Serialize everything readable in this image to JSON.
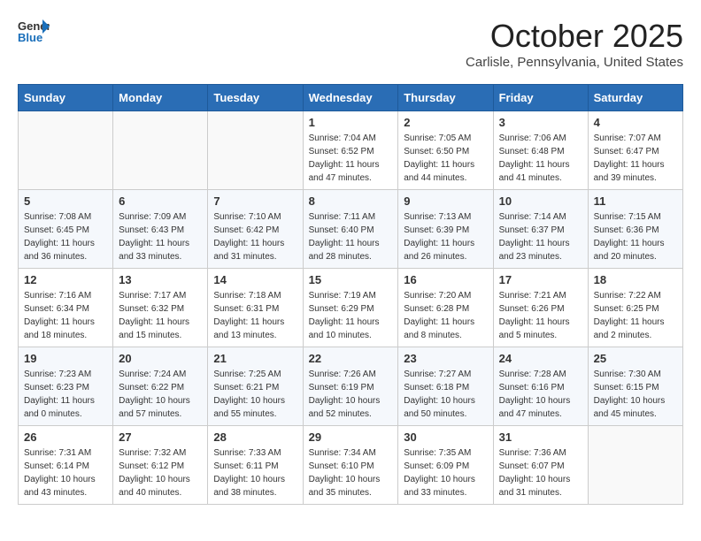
{
  "header": {
    "logo_line1": "General",
    "logo_line2": "Blue",
    "month": "October 2025",
    "location": "Carlisle, Pennsylvania, United States"
  },
  "weekdays": [
    "Sunday",
    "Monday",
    "Tuesday",
    "Wednesday",
    "Thursday",
    "Friday",
    "Saturday"
  ],
  "weeks": [
    [
      {
        "day": "",
        "info": ""
      },
      {
        "day": "",
        "info": ""
      },
      {
        "day": "",
        "info": ""
      },
      {
        "day": "1",
        "info": "Sunrise: 7:04 AM\nSunset: 6:52 PM\nDaylight: 11 hours and 47 minutes."
      },
      {
        "day": "2",
        "info": "Sunrise: 7:05 AM\nSunset: 6:50 PM\nDaylight: 11 hours and 44 minutes."
      },
      {
        "day": "3",
        "info": "Sunrise: 7:06 AM\nSunset: 6:48 PM\nDaylight: 11 hours and 41 minutes."
      },
      {
        "day": "4",
        "info": "Sunrise: 7:07 AM\nSunset: 6:47 PM\nDaylight: 11 hours and 39 minutes."
      }
    ],
    [
      {
        "day": "5",
        "info": "Sunrise: 7:08 AM\nSunset: 6:45 PM\nDaylight: 11 hours and 36 minutes."
      },
      {
        "day": "6",
        "info": "Sunrise: 7:09 AM\nSunset: 6:43 PM\nDaylight: 11 hours and 33 minutes."
      },
      {
        "day": "7",
        "info": "Sunrise: 7:10 AM\nSunset: 6:42 PM\nDaylight: 11 hours and 31 minutes."
      },
      {
        "day": "8",
        "info": "Sunrise: 7:11 AM\nSunset: 6:40 PM\nDaylight: 11 hours and 28 minutes."
      },
      {
        "day": "9",
        "info": "Sunrise: 7:13 AM\nSunset: 6:39 PM\nDaylight: 11 hours and 26 minutes."
      },
      {
        "day": "10",
        "info": "Sunrise: 7:14 AM\nSunset: 6:37 PM\nDaylight: 11 hours and 23 minutes."
      },
      {
        "day": "11",
        "info": "Sunrise: 7:15 AM\nSunset: 6:36 PM\nDaylight: 11 hours and 20 minutes."
      }
    ],
    [
      {
        "day": "12",
        "info": "Sunrise: 7:16 AM\nSunset: 6:34 PM\nDaylight: 11 hours and 18 minutes."
      },
      {
        "day": "13",
        "info": "Sunrise: 7:17 AM\nSunset: 6:32 PM\nDaylight: 11 hours and 15 minutes."
      },
      {
        "day": "14",
        "info": "Sunrise: 7:18 AM\nSunset: 6:31 PM\nDaylight: 11 hours and 13 minutes."
      },
      {
        "day": "15",
        "info": "Sunrise: 7:19 AM\nSunset: 6:29 PM\nDaylight: 11 hours and 10 minutes."
      },
      {
        "day": "16",
        "info": "Sunrise: 7:20 AM\nSunset: 6:28 PM\nDaylight: 11 hours and 8 minutes."
      },
      {
        "day": "17",
        "info": "Sunrise: 7:21 AM\nSunset: 6:26 PM\nDaylight: 11 hours and 5 minutes."
      },
      {
        "day": "18",
        "info": "Sunrise: 7:22 AM\nSunset: 6:25 PM\nDaylight: 11 hours and 2 minutes."
      }
    ],
    [
      {
        "day": "19",
        "info": "Sunrise: 7:23 AM\nSunset: 6:23 PM\nDaylight: 11 hours and 0 minutes."
      },
      {
        "day": "20",
        "info": "Sunrise: 7:24 AM\nSunset: 6:22 PM\nDaylight: 10 hours and 57 minutes."
      },
      {
        "day": "21",
        "info": "Sunrise: 7:25 AM\nSunset: 6:21 PM\nDaylight: 10 hours and 55 minutes."
      },
      {
        "day": "22",
        "info": "Sunrise: 7:26 AM\nSunset: 6:19 PM\nDaylight: 10 hours and 52 minutes."
      },
      {
        "day": "23",
        "info": "Sunrise: 7:27 AM\nSunset: 6:18 PM\nDaylight: 10 hours and 50 minutes."
      },
      {
        "day": "24",
        "info": "Sunrise: 7:28 AM\nSunset: 6:16 PM\nDaylight: 10 hours and 47 minutes."
      },
      {
        "day": "25",
        "info": "Sunrise: 7:30 AM\nSunset: 6:15 PM\nDaylight: 10 hours and 45 minutes."
      }
    ],
    [
      {
        "day": "26",
        "info": "Sunrise: 7:31 AM\nSunset: 6:14 PM\nDaylight: 10 hours and 43 minutes."
      },
      {
        "day": "27",
        "info": "Sunrise: 7:32 AM\nSunset: 6:12 PM\nDaylight: 10 hours and 40 minutes."
      },
      {
        "day": "28",
        "info": "Sunrise: 7:33 AM\nSunset: 6:11 PM\nDaylight: 10 hours and 38 minutes."
      },
      {
        "day": "29",
        "info": "Sunrise: 7:34 AM\nSunset: 6:10 PM\nDaylight: 10 hours and 35 minutes."
      },
      {
        "day": "30",
        "info": "Sunrise: 7:35 AM\nSunset: 6:09 PM\nDaylight: 10 hours and 33 minutes."
      },
      {
        "day": "31",
        "info": "Sunrise: 7:36 AM\nSunset: 6:07 PM\nDaylight: 10 hours and 31 minutes."
      },
      {
        "day": "",
        "info": ""
      }
    ]
  ]
}
